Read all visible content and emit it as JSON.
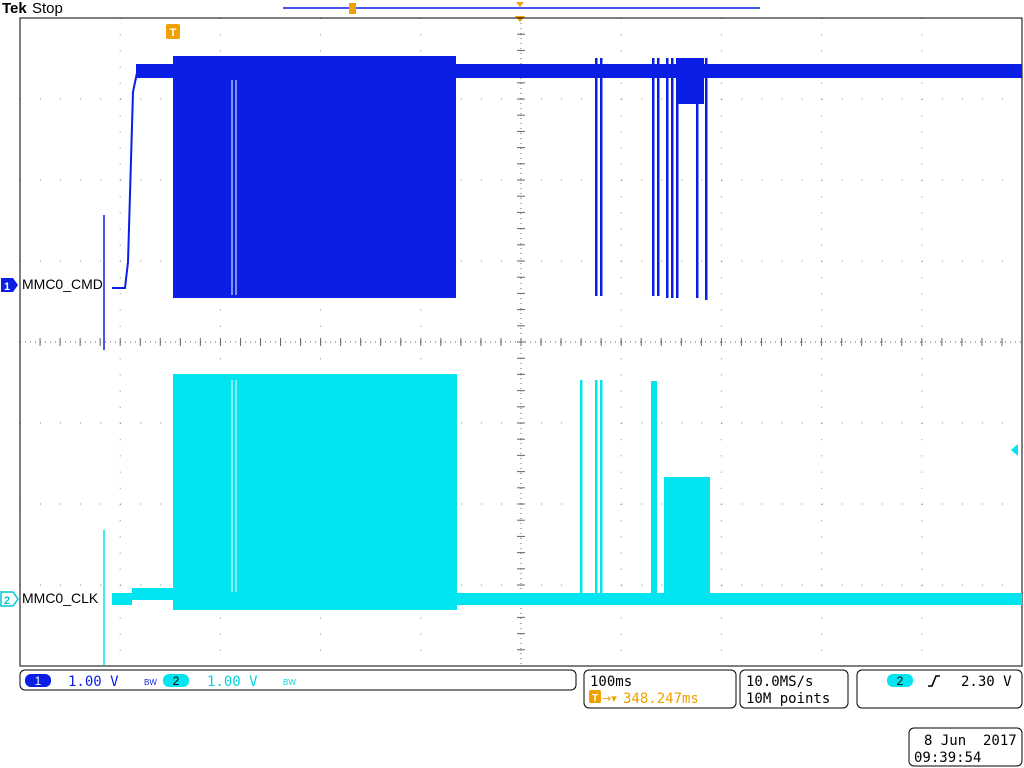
{
  "brand": "Tek",
  "acq_state": "Stop",
  "markers": {
    "trigger_position": "T",
    "trigger_glyph": "T"
  },
  "channels": [
    {
      "number": "1",
      "label": "MMC0_CMD",
      "color": "#0a1ee6",
      "scale": "1.00 V",
      "bw": "BW"
    },
    {
      "number": "2",
      "label": "MMC0_CLK",
      "color": "#00e5f0",
      "scale": "1.00 V",
      "bw": "BW"
    }
  ],
  "timebase": {
    "scale": "100ms",
    "trigger_delay": "348.247ms"
  },
  "acquisition": {
    "sample_rate": "10.0MS/s",
    "record_length": "10M points"
  },
  "trigger": {
    "source": "2",
    "slope": "rising",
    "level": "2.30 V"
  },
  "datetime": {
    "date": "8 Jun  2017",
    "time": "09:39:54"
  },
  "colors": {
    "trigger_accent": "#f0a000",
    "grid": "#000000",
    "frame": "#000000"
  }
}
